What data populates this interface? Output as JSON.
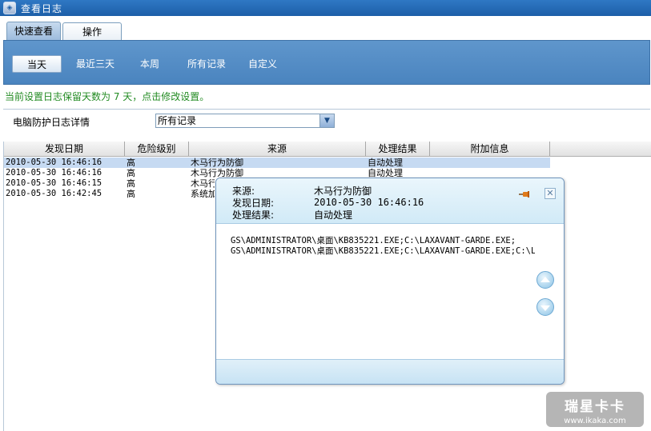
{
  "window": {
    "title": "查看日志"
  },
  "tabs": [
    {
      "label": "快速查看",
      "active": true
    },
    {
      "label": "操作",
      "active": false
    }
  ],
  "quick_filters": [
    {
      "label": "当天",
      "active": true
    },
    {
      "label": "最近三天",
      "active": false
    },
    {
      "label": "本周",
      "active": false
    },
    {
      "label": "所有记录",
      "active": false
    },
    {
      "label": "自定义",
      "active": false
    }
  ],
  "notice": "当前设置日志保留天数为 7 天，点击修改设置。",
  "filter": {
    "label": "电脑防护日志详情",
    "selected": "所有记录"
  },
  "table": {
    "columns": [
      "发现日期",
      "危险级别",
      "来源",
      "处理结果",
      "附加信息"
    ],
    "rows": [
      {
        "date": "2010-05-30 16:46:16",
        "level": "高",
        "source": "木马行为防御",
        "result": "自动处理",
        "extra": ""
      },
      {
        "date": "2010-05-30 16:46:16",
        "level": "高",
        "source": "木马行为防御",
        "result": "自动处理",
        "extra": ""
      },
      {
        "date": "2010-05-30 16:46:15",
        "level": "高",
        "source": "木马行为防御",
        "result": "",
        "extra": ""
      },
      {
        "date": "2010-05-30 16:42:45",
        "level": "高",
        "source": "系统加",
        "result": "",
        "extra": ""
      }
    ]
  },
  "popup": {
    "source_label": "来源:",
    "source_value": "木马行为防御",
    "date_label": "发现日期:",
    "date_value": "2010-05-30 16:46:16",
    "result_label": "处理结果:",
    "result_value": "自动处理",
    "details": [
      "GS\\ADMINISTRATOR\\桌面\\KB835221.EXE;C:\\LAXAVANT-GARDE.EXE;",
      "GS\\ADMINISTRATOR\\桌面\\KB835221.EXE;C:\\LAXAVANT-GARDE.EXE;C:\\L"
    ]
  },
  "watermark": {
    "main": "瑞星卡卡",
    "url": "www.ikaka.com"
  },
  "colors": {
    "title_bar": "#1c5ea8",
    "quickbar": "#5f96cc",
    "notice": "#228b22",
    "selected_row": "#c6daf2"
  }
}
